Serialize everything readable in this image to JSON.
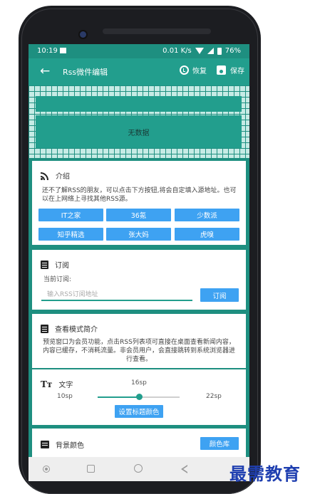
{
  "status": {
    "time": "10:19",
    "net_speed": "0.01 K/s",
    "battery": "76%"
  },
  "appbar": {
    "title": "Rss微件编辑",
    "restore_label": "恢复",
    "save_label": "保存"
  },
  "widget": {
    "empty_text": "无数据"
  },
  "intro": {
    "title": "介绍",
    "text": "还不了解RSS的朋友，可以点击下方按钮,将会自定填入源地址。也可以在上网络上寻找其他RSS源。",
    "sources": [
      "IT之家",
      "36氪",
      "少数派",
      "知乎精选",
      "张大妈",
      "虎嗅"
    ]
  },
  "subscribe": {
    "title": "订阅",
    "current_label": "当前订阅:",
    "input_placeholder": "输入RSS订阅地址",
    "button": "订阅"
  },
  "mode": {
    "title": "查看模式简介",
    "text": "预览窗口为会员功能，点击RSS列表项可直接在桌面查看新闻内容，内容已缓存，不消耗流量。非会员用户，会直接跳转到系统浏览器进行查看。"
  },
  "text_size": {
    "title": "文字",
    "current": "16sp",
    "min": "10sp",
    "max": "22sp",
    "value": 16,
    "range": [
      10,
      22
    ],
    "title_color_button": "设置标题颜色"
  },
  "background": {
    "title": "背景颜色",
    "library_button": "颜色库"
  },
  "colors": {
    "primary": "#229e8d",
    "accent": "#3ea2f2"
  },
  "watermark": "最需教育"
}
